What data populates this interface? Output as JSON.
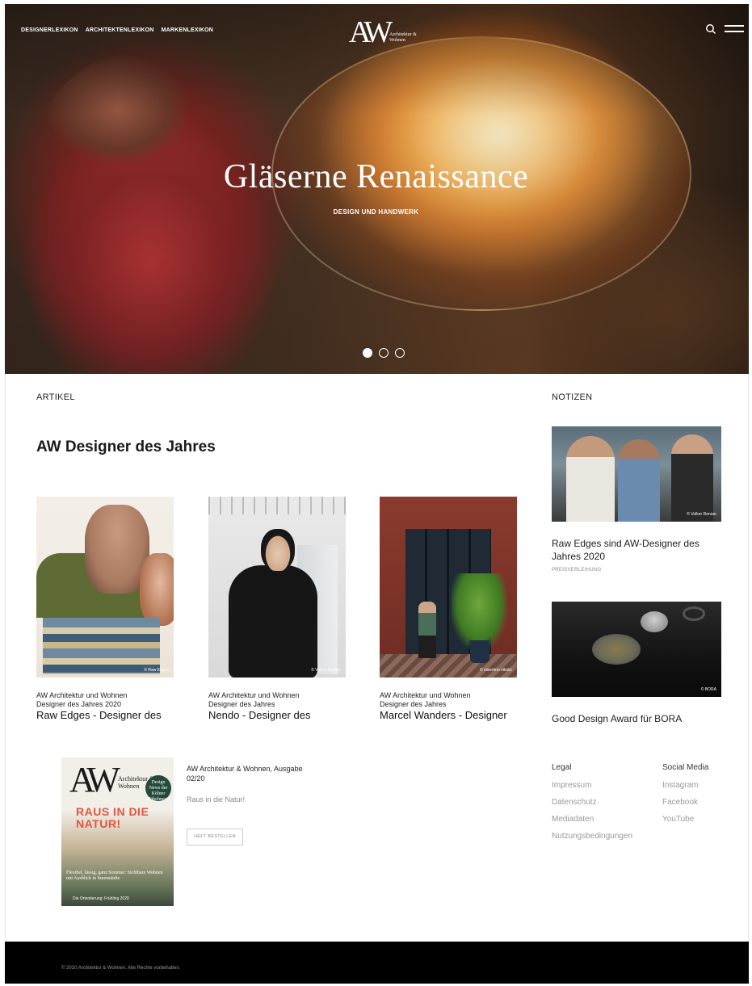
{
  "nav": {
    "items": [
      {
        "label": "DESIGNERLEXIKON"
      },
      {
        "label": "ARCHITEKTENLEXIKON"
      },
      {
        "label": "MARKENLEXIKON"
      }
    ]
  },
  "logo": {
    "mark": "AW",
    "sub": "Architektur & Wohnen"
  },
  "hero": {
    "title": "Gläserne Renaissance",
    "subtitle": "DESIGN UND HANDWERK",
    "slides": 3,
    "active_slide": 1
  },
  "articles": {
    "section_label": "ARTIKEL",
    "heading": "AW Designer des Jahres",
    "cards": [
      {
        "source": "AW Architektur und Wohnen",
        "series": "Designer des Jahres 2020",
        "title": "Raw Edges - Designer des",
        "credit": "© Raw Edges"
      },
      {
        "source": "AW Architektur und Wohnen",
        "series": "Designer des Jahres",
        "title": "Nendo - Designer des",
        "credit": "© Volker Renner"
      },
      {
        "source": "AW Architektur und Wohnen",
        "series": "Designer des Jahres",
        "title": "Marcel Wanders - Designer",
        "credit": "© robertino nikolic"
      }
    ]
  },
  "notes": {
    "section_label": "NOTIZEN",
    "items": [
      {
        "title": "Raw Edges sind AW-Designer des Jahres 2020",
        "tag": "PREISVERLEIHUNG",
        "credit": "© Volker Renner"
      },
      {
        "title": "Good Design Award für BORA",
        "tag": "",
        "credit": "© BORA"
      }
    ]
  },
  "issue": {
    "title": "AW Architektur & Wohnen, Ausgabe 02/20",
    "teaser": "Raus in die Natur!",
    "button": "HEFT BESTELLEN",
    "cover": {
      "mark": "AW",
      "sub": "Architektur & Wohnen",
      "badge": "Design News der Kölner Möbelmesse",
      "headline": "RAUS IN DIE NATUR!",
      "bottom": "Flexibel, lässig, ganz Sommer: Sichtbare Wohnen mit Ausblick in Innenstädte",
      "bottom2": "Die Orientierung: Frühling 2020"
    }
  },
  "legal": {
    "heading": "Legal",
    "links": [
      "Impressum",
      "Datenschutz",
      "Mediadaten",
      "Nutzungsbedingungen"
    ]
  },
  "social": {
    "heading": "Social Media",
    "links": [
      "Instagram",
      "Facebook",
      "YouTube"
    ]
  },
  "footer": {
    "copyright": "© 2020 Architektur & Wohnen. Alle Rechte vorbehalten."
  }
}
